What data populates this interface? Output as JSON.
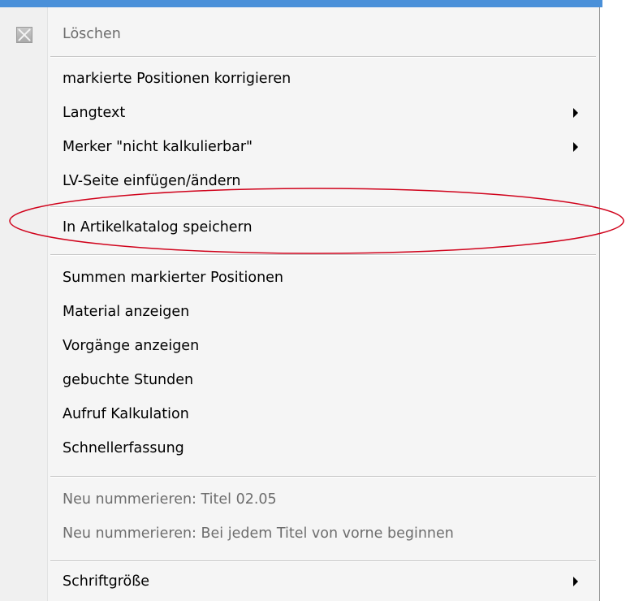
{
  "colors": {
    "menu_background": "#f5f5f5",
    "text": "#000000",
    "disabled_text": "#6d6d6d",
    "annotation": "#d0021b",
    "title_bar": "#4a90d9"
  },
  "context_menu": {
    "delete": {
      "label": "Löschen",
      "icon": "delete-x-icon",
      "disabled": true
    },
    "group1": [
      {
        "label": "markierte Positionen korrigieren",
        "submenu": false
      },
      {
        "label": "Langtext",
        "submenu": true
      },
      {
        "label": "Merker \"nicht kalkulierbar\"",
        "submenu": true
      },
      {
        "label": "LV-Seite einfügen/ändern",
        "submenu": false
      }
    ],
    "group2": [
      {
        "label": "In Artikelkatalog speichern",
        "submenu": false,
        "highlighted_by_annotation": true
      }
    ],
    "group3": [
      {
        "label": "Summen markierter Positionen",
        "submenu": false
      },
      {
        "label": "Material anzeigen",
        "submenu": false
      },
      {
        "label": "Vorgänge anzeigen",
        "submenu": false
      },
      {
        "label": "gebuchte Stunden",
        "submenu": false
      },
      {
        "label": "Aufruf Kalkulation",
        "submenu": false
      },
      {
        "label": "Schnellerfassung",
        "submenu": false
      }
    ],
    "group4": [
      {
        "label": "Neu nummerieren: Titel 02.05",
        "disabled": true
      },
      {
        "label": "Neu nummerieren: Bei jedem Titel von vorne beginnen",
        "disabled": true
      }
    ],
    "group5": [
      {
        "label": "Schriftgröße",
        "submenu": true
      }
    ]
  }
}
